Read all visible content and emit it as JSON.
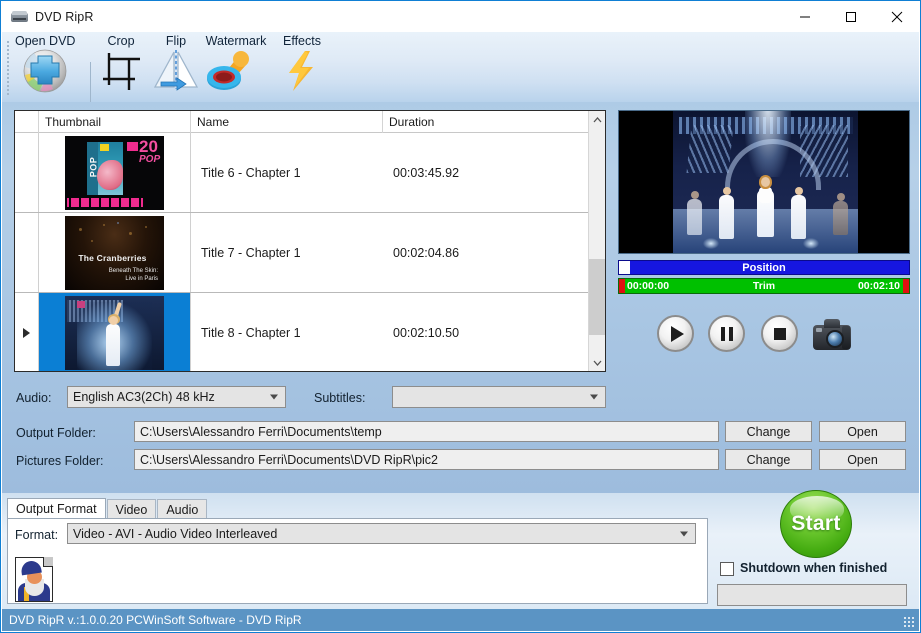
{
  "window": {
    "title": "DVD RipR",
    "icon": "dvd-drive-icon",
    "controls": {
      "minimize": "—",
      "maximize": "□",
      "close": "✕"
    }
  },
  "toolbar": {
    "items": [
      {
        "label": "Open DVD",
        "icon": "dvd-plus-icon"
      },
      {
        "label": "Crop",
        "icon": "crop-icon"
      },
      {
        "label": "Flip",
        "icon": "flip-icon"
      },
      {
        "label": "Watermark",
        "icon": "stamp-icon"
      },
      {
        "label": "Effects",
        "icon": "lightning-bolt-icon"
      }
    ]
  },
  "file_list": {
    "columns": [
      "",
      "Thumbnail",
      "Name",
      "Duration"
    ],
    "rows": [
      {
        "name": "Title 6 - Chapter 1",
        "duration": "00:03:45.92",
        "thumb": "mtv-20-pop-cover",
        "selected": false,
        "indicator": ""
      },
      {
        "name": "Title 7 - Chapter 1",
        "duration": "00:02:04.86",
        "thumb": "cranberries-live-in-paris",
        "selected": false,
        "indicator": ""
      },
      {
        "name": "Title 8 - Chapter 1",
        "duration": "00:02:10.50",
        "thumb": "stage-singer",
        "selected": true,
        "indicator": "▶"
      }
    ],
    "thumb_labels": {
      "mtv_20": "20",
      "mtv_pop": "POP",
      "cover_pop": "POP",
      "cranberries_title": "The Cranberries",
      "cranberries_sub1": "Beneath The Skin:",
      "cranberries_sub2": "Live in Paris"
    }
  },
  "audio_row": {
    "audio_label": "Audio:",
    "audio_value": "English AC3(2Ch) 48 kHz",
    "subtitles_label": "Subtitles:",
    "subtitles_value": ""
  },
  "folders": {
    "output_label": "Output Folder:",
    "output_value": "C:\\Users\\Alessandro Ferri\\Documents\\temp",
    "pictures_label": "Pictures Folder:",
    "pictures_value": "C:\\Users\\Alessandro Ferri\\Documents\\DVD RipR\\pic2",
    "change_label": "Change",
    "open_label": "Open"
  },
  "player": {
    "position_label": "Position",
    "trim_label": "Trim",
    "trim_start": "00:00:00",
    "trim_end": "00:02:10",
    "buttons": [
      {
        "name": "play-button",
        "glyph": "▶"
      },
      {
        "name": "pause-button",
        "glyph": "❚❚"
      },
      {
        "name": "stop-button",
        "glyph": "■"
      },
      {
        "name": "snapshot-button",
        "glyph": "camera"
      }
    ],
    "colors": {
      "position_bar": "#1616e0",
      "trim_bar": "#00c000",
      "trim_edge": "#e01010"
    }
  },
  "bottom": {
    "tabs": [
      {
        "label": "Output Format",
        "active": true
      },
      {
        "label": "Video",
        "active": false
      },
      {
        "label": "Audio",
        "active": false
      }
    ],
    "format_label": "Format:",
    "format_value": "Video - AVI - Audio Video Interleaved",
    "wizard_icon": "wizard-icon",
    "start_label": "Start",
    "shutdown_label": "Shutdown when finished",
    "shutdown_checked": false,
    "progress_value": ""
  },
  "statusbar": {
    "text": "DVD RipR v.:1.0.0.20 PCWinSoft Software - DVD RipR"
  },
  "colors": {
    "accent": "#0b7fd4",
    "status_bg": "#5b94c4",
    "start_green": "#46ad12",
    "panel_blue": "#aecbe6"
  }
}
